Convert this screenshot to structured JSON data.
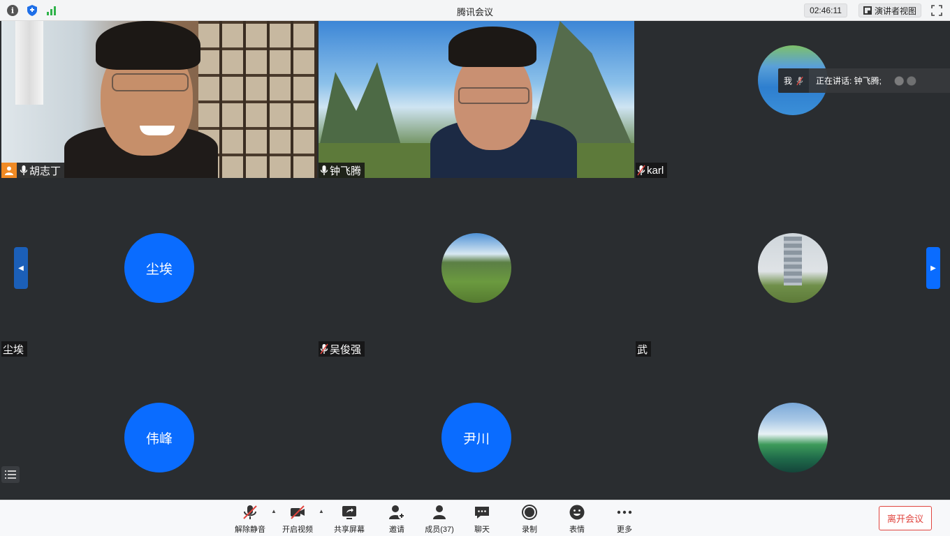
{
  "titlebar": {
    "title": "腾讯会议",
    "clock": "02:46:11",
    "speaker_view_label": "演讲者视图"
  },
  "tiles": [
    {
      "name": "胡志丁",
      "type": "video",
      "host": true,
      "mic": "on"
    },
    {
      "name": "钟飞腾",
      "type": "video",
      "host": false,
      "mic": "on",
      "active_speaker": true
    },
    {
      "name": "karl",
      "type": "avatar-image",
      "mic": "muted"
    },
    {
      "name": "尘埃",
      "type": "avatar-text",
      "avatar_text": "尘埃"
    },
    {
      "name": "吴俊强",
      "type": "avatar-image",
      "mic": "muted"
    },
    {
      "name": "武",
      "type": "avatar-image"
    },
    {
      "name": "",
      "type": "avatar-text",
      "avatar_text": "伟峰"
    },
    {
      "name": "",
      "type": "avatar-text",
      "avatar_text": "尹川"
    },
    {
      "name": "",
      "type": "avatar-image"
    }
  ],
  "speaking_overlay": {
    "me_label": "我",
    "talking_label": "正在讲话: 钟飞腾;"
  },
  "toolbar": {
    "unmute": "解除静音",
    "start_video": "开启视频",
    "share_screen": "共享屏幕",
    "invite": "邀请",
    "members": "成员(37)",
    "chat": "聊天",
    "record": "录制",
    "reactions": "表情",
    "more": "更多",
    "leave": "离开会议"
  },
  "colors": {
    "accent_blue": "#0a6cff",
    "leave_red": "#e0443e",
    "active_green": "#21c35d",
    "host_orange": "#f08a24"
  }
}
